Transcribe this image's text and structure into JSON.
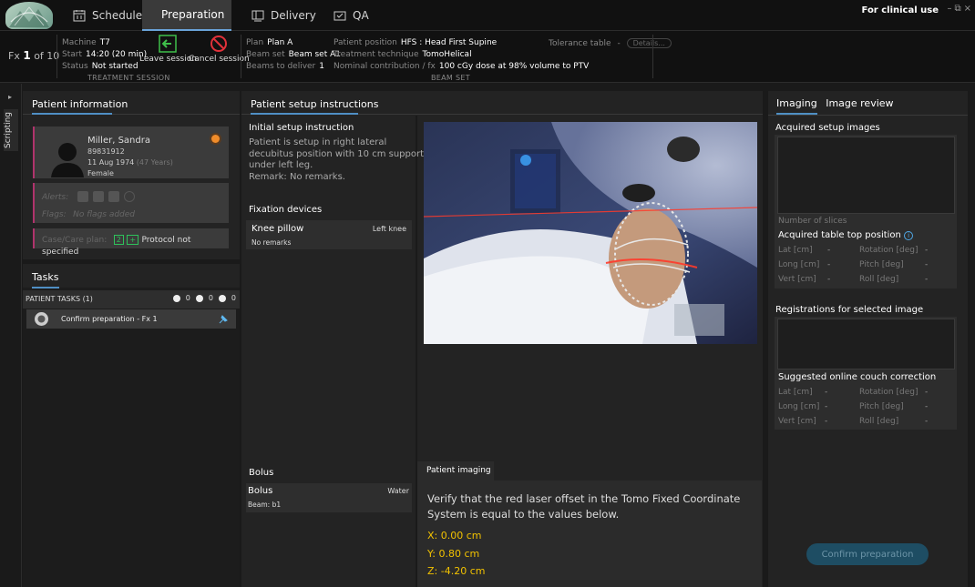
{
  "nav": {
    "tabs": [
      {
        "label": "Schedule",
        "icon": "calendar-icon"
      },
      {
        "label": "Preparation",
        "icon": "person-icon"
      },
      {
        "label": "Delivery",
        "icon": "delivery-icon"
      },
      {
        "label": "QA",
        "icon": "qa-icon"
      }
    ],
    "active_tab": "Preparation",
    "clinical_label": "For clinical use",
    "window_controls": [
      "–",
      "⧉",
      "×"
    ]
  },
  "session": {
    "fx_prefix": "Fx",
    "fx_current": "1",
    "fx_of": "of 10",
    "machine_label": "Machine",
    "machine": "T7",
    "start_label": "Start",
    "start": "14:20 (20 min)",
    "status_label": "Status",
    "status": "Not started",
    "caption": "TREATMENT SESSION",
    "leave_label": "Leave session",
    "cancel_label": "Cancel session"
  },
  "beamset": {
    "plan_label": "Plan",
    "plan": "Plan A",
    "beamset_label": "Beam set",
    "beamset": "Beam set A1",
    "beams_label": "Beams to deliver",
    "beams": "1",
    "position_label": "Patient position",
    "position": "HFS : Head First Supine",
    "technique_label": "Treatment technique",
    "technique": "TomoHelical",
    "contribution_label": "Nominal contribution / fx",
    "contribution": "100 cGy dose at 98% volume to PTV",
    "tolerance_label": "Tolerance table",
    "tolerance": "-",
    "details_label": "Details...",
    "caption": "BEAM SET"
  },
  "scripting": {
    "label": "Scripting",
    "toggle": "▸"
  },
  "patient_info": {
    "title": "Patient information",
    "name": "Miller, Sandra",
    "id": "89831912",
    "dob": "11 Aug 1974",
    "age": "(47 Years)",
    "sex": "Female",
    "alerts_label": "Alerts:",
    "flags_label": "Flags:",
    "flags_value": "No flags added",
    "case_label": "Case/Care plan:",
    "case_badges": [
      "2",
      "+"
    ],
    "protocol": "Protocol not specified"
  },
  "tasks": {
    "title": "Tasks",
    "group_label": "PATIENT TASKS (1)",
    "counts": [
      "0",
      "0",
      "0"
    ],
    "items": [
      {
        "label": "Confirm preparation - Fx 1"
      }
    ]
  },
  "setup": {
    "title": "Patient setup instructions",
    "initial_title": "Initial setup instruction",
    "initial_lines": [
      "Patient is setup in right lateral",
      "decubitus position with 10 cm support",
      "under left leg.",
      "Remark: No remarks."
    ],
    "fixation_title": "Fixation devices",
    "fixation": {
      "name": "Knee pillow",
      "location": "Left knee",
      "remarks": "No remarks"
    },
    "bolus_title": "Bolus",
    "bolus": {
      "name": "Bolus",
      "material": "Water",
      "beam": "Beam: b1"
    }
  },
  "patient_imaging": {
    "tab_label": "Patient imaging",
    "verify_text": "Verify that the red laser offset in the Tomo Fixed Coordinate System is equal to the values below.",
    "x": "X: 0.00 cm",
    "y": "Y: 0.80 cm",
    "z": "Z: -4.20 cm"
  },
  "imaging": {
    "tab_imaging": "Imaging",
    "tab_review": "Image review",
    "acquired_title": "Acquired setup images",
    "slices_label": "Number of slices",
    "table_pos_title": "Acquired table top position",
    "lat_label": "Lat [cm]",
    "long_label": "Long [cm]",
    "vert_label": "Vert [cm]",
    "rot_label": "Rotation [deg]",
    "pitch_label": "Pitch [deg]",
    "roll_label": "Roll [deg]",
    "dash": "-",
    "registrations_title": "Registrations for selected image",
    "couch_title": "Suggested online couch correction",
    "confirm_label": "Confirm preparation"
  }
}
